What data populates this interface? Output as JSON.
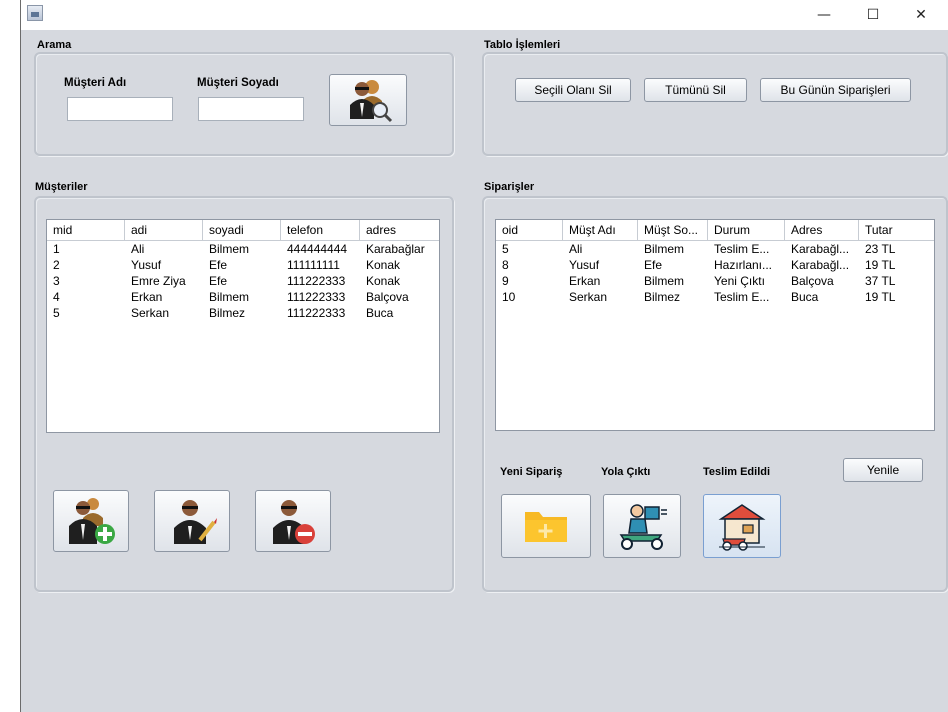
{
  "window": {
    "minimize": "—",
    "maximize": "☐",
    "close": "✕"
  },
  "search": {
    "title": "Arama",
    "first_name_label": "Müşteri Adı",
    "last_name_label": "Müşteri Soyadı",
    "first_name_value": "",
    "last_name_value": "",
    "search_icon": "customer-search-icon"
  },
  "table_ops": {
    "title": "Tablo İşlemleri",
    "delete_selected": "Seçili Olanı Sil",
    "delete_all": "Tümünü Sil",
    "today_orders": "Bu Günün Siparişleri"
  },
  "customers": {
    "title": "Müşteriler",
    "columns": [
      "mid",
      "adi",
      "soyadi",
      "telefon",
      "adres"
    ],
    "rows": [
      [
        "1",
        "Ali",
        "Bilmem",
        "444444444",
        "Karabağlar"
      ],
      [
        "2",
        "Yusuf",
        "Efe",
        "111111111",
        "Konak"
      ],
      [
        "3",
        "Emre Ziya",
        "Efe",
        "111222333",
        "Konak"
      ],
      [
        "4",
        "Erkan",
        "Bilmem",
        "111222333",
        "Balçova"
      ],
      [
        "5",
        "Serkan",
        "Bilmez",
        "111222333",
        "Buca"
      ]
    ],
    "actions": [
      "add-customer-icon",
      "edit-customer-icon",
      "delete-customer-icon"
    ]
  },
  "orders": {
    "title": "Siparişler",
    "columns": [
      "oid",
      "Müşt Adı",
      "Müşt So...",
      "Durum",
      "Adres",
      "Tutar"
    ],
    "rows": [
      [
        "5",
        "Ali",
        "Bilmem",
        "Teslim E...",
        "Karabağl...",
        "23 TL"
      ],
      [
        "8",
        "Yusuf",
        "Efe",
        "Hazırlanı...",
        "Karabağl...",
        "19 TL"
      ],
      [
        "9",
        "Erkan",
        "Bilmem",
        "Yeni Çıktı",
        "Balçova",
        "37 TL"
      ],
      [
        "10",
        "Serkan",
        "Bilmez",
        "Teslim E...",
        "Buca",
        "19 TL"
      ]
    ],
    "new_order_label": "Yeni Sipariş",
    "on_the_way_label": "Yola Çıktı",
    "delivered_label": "Teslim Edildi",
    "refresh": "Yenile"
  }
}
